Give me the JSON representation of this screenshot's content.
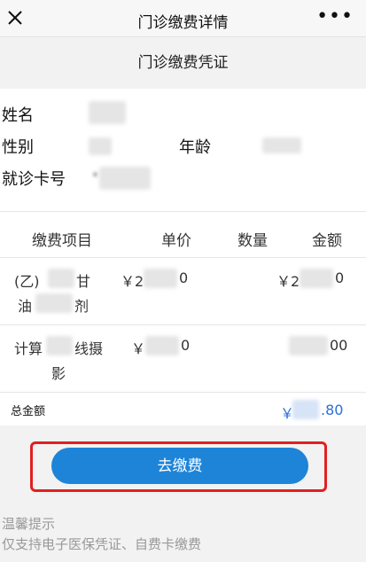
{
  "nav": {
    "title": "门诊缴费详情",
    "more": "•••"
  },
  "subtitle": "门诊缴费凭证",
  "patient": {
    "name_label": "姓名",
    "gender_label": "性别",
    "age_label": "年龄",
    "card_label": "就诊卡号",
    "card_value_visible": "*"
  },
  "table": {
    "headers": [
      "缴费项目",
      "单价",
      "数量",
      "金额"
    ],
    "rows": [
      {
        "item_line1": "(乙)",
        "item_tail1": "甘",
        "item_line2": "油",
        "item_tail2": "剂",
        "price_prefix": "￥2",
        "price_suffix": "0",
        "amount_prefix": "￥2",
        "amount_suffix": "0"
      },
      {
        "item_line1": "计算",
        "item_tail1": "线摄",
        "item_line2": "影",
        "price_prefix": "￥",
        "price_suffix": "0",
        "amount_prefix": "",
        "amount_suffix": "00"
      }
    ],
    "total_label": "总金额",
    "total_prefix": "￥",
    "total_suffix": ".80"
  },
  "pay_button": "去缴费",
  "tips": {
    "title": "温馨提示",
    "text": "仅支持电子医保凭证、自费卡缴费"
  },
  "colors": {
    "accent": "#1e84d8",
    "highlight": "#e02020",
    "amount": "#2c6fd8"
  }
}
